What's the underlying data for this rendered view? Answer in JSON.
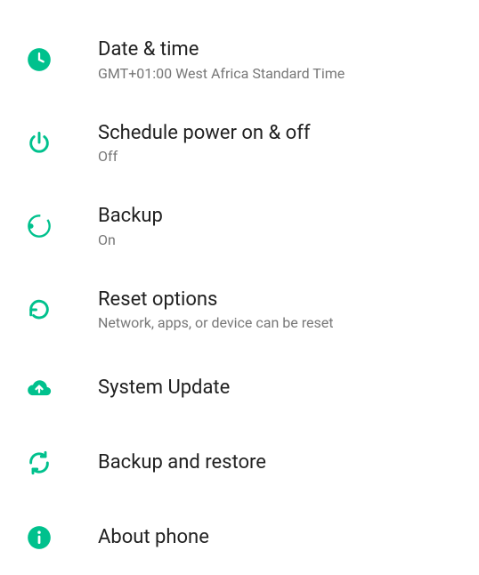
{
  "items": [
    {
      "title": "Date & time",
      "subtitle": "GMT+01:00 West Africa Standard Time"
    },
    {
      "title": "Schedule power on & off",
      "subtitle": "Off"
    },
    {
      "title": "Backup",
      "subtitle": "On"
    },
    {
      "title": "Reset options",
      "subtitle": "Network, apps, or device can be reset"
    },
    {
      "title": "System Update",
      "subtitle": null
    },
    {
      "title": "Backup and restore",
      "subtitle": null
    },
    {
      "title": "About phone",
      "subtitle": null
    }
  ],
  "colors": {
    "accent": "#00c18d"
  }
}
